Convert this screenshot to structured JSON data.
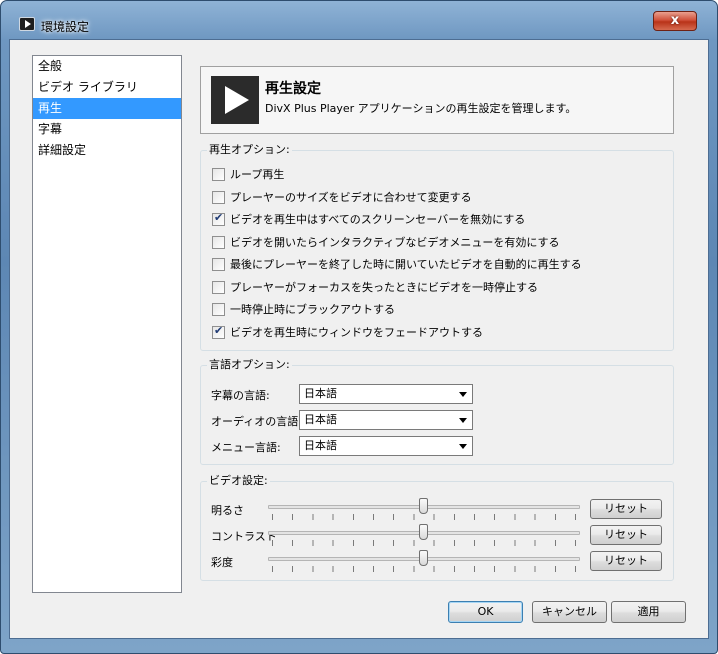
{
  "window": {
    "title": "環境設定",
    "close_glyph": "x"
  },
  "nav": {
    "items": [
      {
        "label": "全般",
        "selected": false
      },
      {
        "label": "ビデオ ライブラリ",
        "selected": false
      },
      {
        "label": "再生",
        "selected": true
      },
      {
        "label": "字幕",
        "selected": false
      },
      {
        "label": "詳細設定",
        "selected": false
      }
    ]
  },
  "header": {
    "icon": "play-icon",
    "title": "再生設定",
    "description": "DivX Plus Player アプリケーションの再生設定を管理します。"
  },
  "playback_options": {
    "label": "再生オプション:",
    "items": [
      {
        "label": "ループ再生",
        "checked": false
      },
      {
        "label": "プレーヤーのサイズをビデオに合わせて変更する",
        "checked": false
      },
      {
        "label": "ビデオを再生中はすべてのスクリーンセーバーを無効にする",
        "checked": true
      },
      {
        "label": "ビデオを開いたらインタラクティブなビデオメニューを有効にする",
        "checked": false
      },
      {
        "label": "最後にプレーヤーを終了した時に開いていたビデオを自動的に再生する",
        "checked": false
      },
      {
        "label": "プレーヤーがフォーカスを失ったときにビデオを一時停止する",
        "checked": false
      },
      {
        "label": "一時停止時にブラックアウトする",
        "checked": false
      },
      {
        "label": "ビデオを再生時にウィンドウをフェードアウトする",
        "checked": true
      }
    ]
  },
  "language_options": {
    "label": "言語オプション:",
    "subtitle_label": "字幕の言語:",
    "subtitle_value": "日本語",
    "audio_label": "オーディオの言語:",
    "audio_value": "日本語",
    "menu_label": "メニュー言語:",
    "menu_value": "日本語"
  },
  "video_settings": {
    "label": "ビデオ設定:",
    "sliders": [
      {
        "label": "明るさ",
        "level": 0.5,
        "reset": "リセット"
      },
      {
        "label": "コントラスト",
        "level": 0.5,
        "reset": "リセット"
      },
      {
        "label": "彩度",
        "level": 0.5,
        "reset": "リセット"
      }
    ]
  },
  "buttons": {
    "ok": "OK",
    "cancel": "キャンセル",
    "apply": "適用"
  }
}
